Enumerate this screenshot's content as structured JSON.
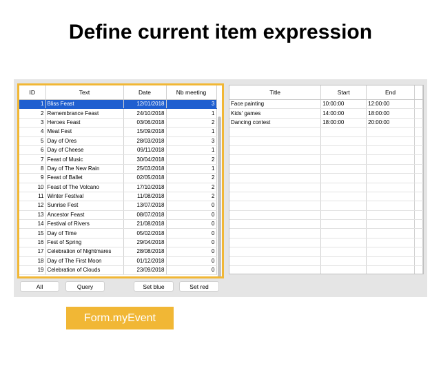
{
  "page": {
    "title": "Define current item expression"
  },
  "left_list": {
    "columns": [
      "ID",
      "Text",
      "Date",
      "Nb meeting"
    ],
    "selected_row": 0,
    "rows": [
      [
        "1",
        "Bliss Feast",
        "12/01/2018",
        "3"
      ],
      [
        "2",
        "Remembrance Feast",
        "24/10/2018",
        "1"
      ],
      [
        "3",
        "Heroes Feast",
        "03/06/2018",
        "2"
      ],
      [
        "4",
        "Meat Fest",
        "15/09/2018",
        "1"
      ],
      [
        "5",
        "Day of Ores",
        "28/03/2018",
        "3"
      ],
      [
        "6",
        "Day of Cheese",
        "09/11/2018",
        "1"
      ],
      [
        "7",
        "Feast of Music",
        "30/04/2018",
        "2"
      ],
      [
        "8",
        "Day of The New Rain",
        "25/03/2018",
        "1"
      ],
      [
        "9",
        "Feast of Ballet",
        "02/05/2018",
        "2"
      ],
      [
        "10",
        "Feast of The Volcano",
        "17/10/2018",
        "2"
      ],
      [
        "11",
        "Winter Festival",
        "11/08/2018",
        "2"
      ],
      [
        "12",
        "Sunrise Fest",
        "13/07/2018",
        "0"
      ],
      [
        "13",
        "Ancestor Feast",
        "08/07/2018",
        "0"
      ],
      [
        "14",
        "Festival of Rivers",
        "21/08/2018",
        "0"
      ],
      [
        "15",
        "Day of Time",
        "05/02/2018",
        "0"
      ],
      [
        "16",
        "Fest of Spring",
        "29/04/2018",
        "0"
      ],
      [
        "17",
        "Celebration of Nightmares",
        "28/08/2018",
        "0"
      ],
      [
        "18",
        "Day of The First Moon",
        "01/12/2018",
        "0"
      ],
      [
        "19",
        "Celebration of Clouds",
        "23/09/2018",
        "0"
      ]
    ]
  },
  "right_list": {
    "columns": [
      "Title",
      "Start",
      "End"
    ],
    "rows": [
      [
        "Face painting",
        "10:00:00",
        "12:00:00"
      ],
      [
        "Kids' games",
        "14:00:00",
        "18:00:00"
      ],
      [
        "Dancing contest",
        "18:00:00",
        "20:00:00"
      ]
    ],
    "empty_rows": 18
  },
  "buttons": {
    "all": "All",
    "query": "Query",
    "set_blue": "Set blue",
    "set_red": "Set red"
  },
  "event_label": "Form.myEvent",
  "colors": {
    "highlight": "#f1b735",
    "selection": "#1f5fd0"
  }
}
